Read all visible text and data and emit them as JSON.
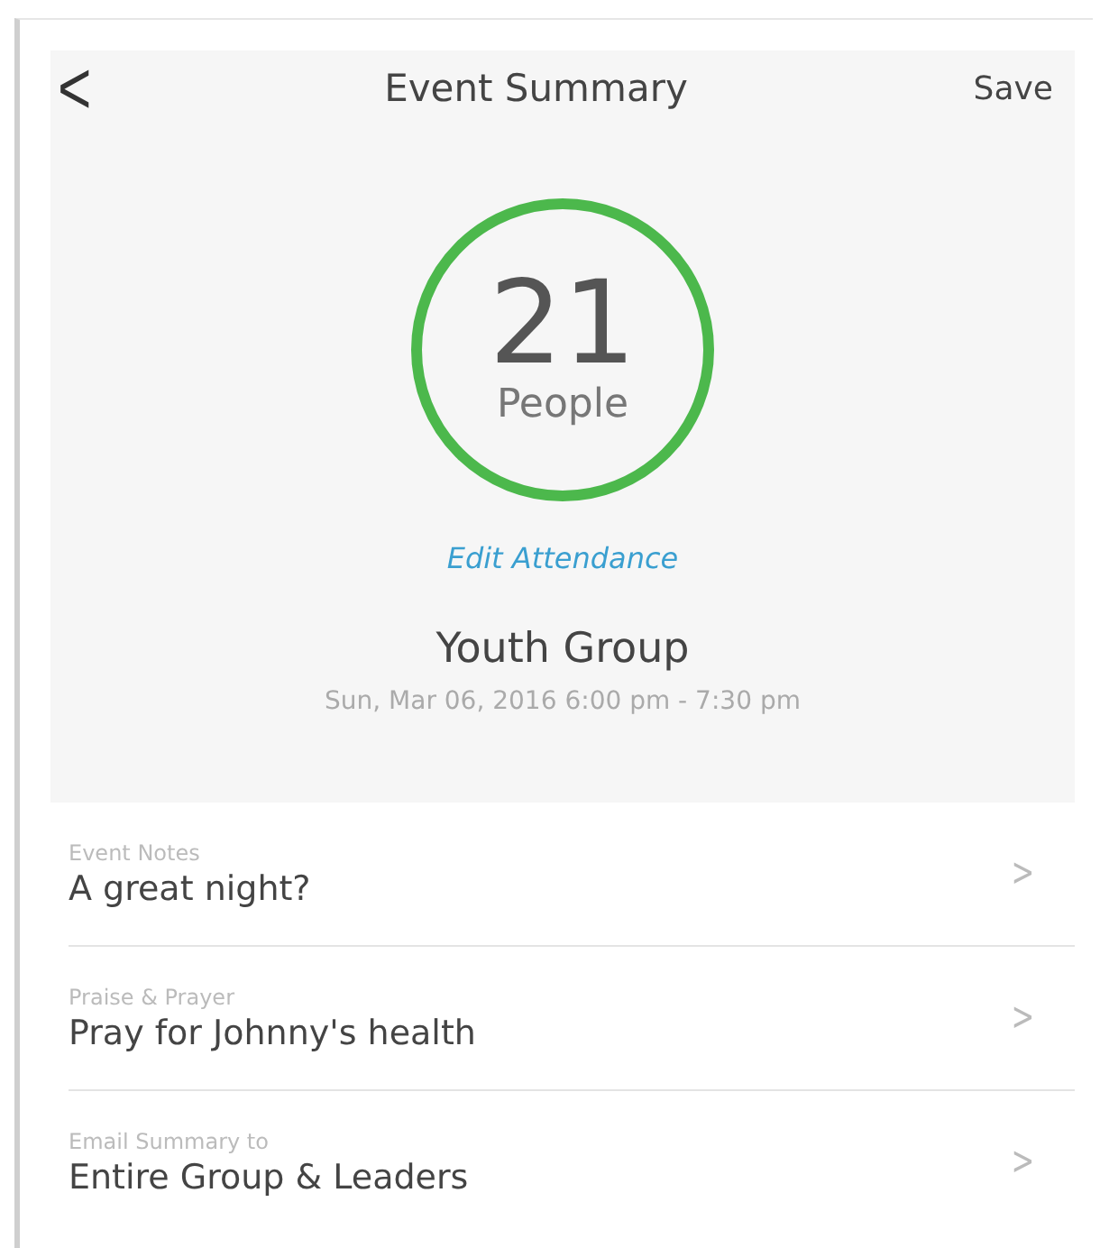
{
  "nav": {
    "back": "<",
    "title": "Event Summary",
    "action": "Save"
  },
  "attendance": {
    "count": "21",
    "unit": "People",
    "edit_link": "Edit Attendance"
  },
  "event": {
    "name": "Youth Group",
    "datetime": "Sun, Mar 06, 2016 6:00 pm - 7:30 pm"
  },
  "rows": [
    {
      "label": "Event Notes",
      "value": "A great night?",
      "chevron": ">"
    },
    {
      "label": "Praise & Prayer",
      "value": "Pray for Johnny's health",
      "chevron": ">"
    },
    {
      "label": "Email Summary to",
      "value": "Entire Group & Leaders",
      "chevron": ">"
    }
  ]
}
